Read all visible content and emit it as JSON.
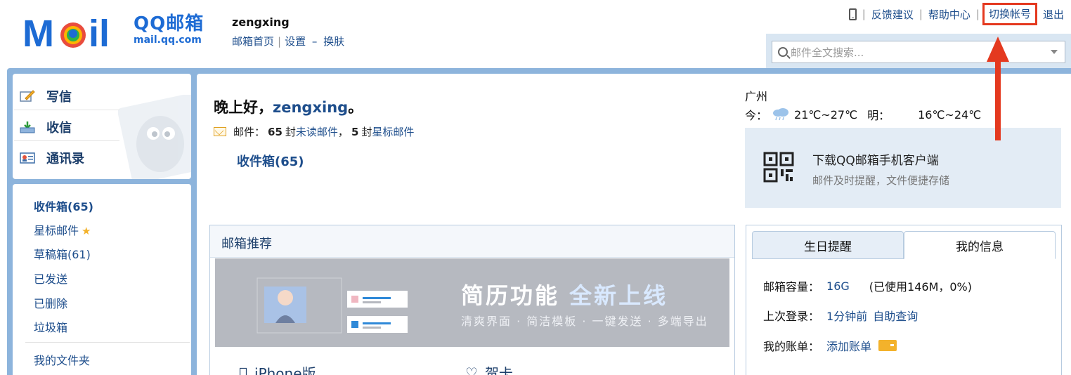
{
  "brand": {
    "logo_text": "Mail",
    "product_name": "QQ邮箱",
    "domain": "mail.qq.com"
  },
  "user": {
    "name": "zengxing",
    "home_link": "邮箱首页",
    "settings_link": "设置",
    "skin_link": "换肤",
    "dash": "–"
  },
  "toplinks": {
    "feedback": "反馈建议",
    "help": "帮助中心",
    "switch_account": "切换帐号",
    "logout": "退出"
  },
  "search": {
    "placeholder": "邮件全文搜索..."
  },
  "sidebar": {
    "compose": "写信",
    "receive": "收信",
    "contacts": "通讯录",
    "folders": [
      {
        "label": "收件箱(65)"
      },
      {
        "label": "星标邮件"
      },
      {
        "label": "草稿箱(61)"
      },
      {
        "label": "已发送"
      },
      {
        "label": "已删除"
      },
      {
        "label": "垃圾箱"
      }
    ],
    "my_folders": "我的文件夹"
  },
  "greeting": {
    "prefix": "晚上好，",
    "name": "zengxing",
    "suffix": "。"
  },
  "mail_summary": {
    "label": "邮件：",
    "unread_count": "65",
    "unit1": "封",
    "unread_label": "未读邮件",
    "comma": "，",
    "star_count": "5",
    "unit2": "封",
    "star_label": "星标邮件"
  },
  "inbox_link": "收件箱(65)",
  "weather": {
    "city": "广州",
    "today_label": "今：",
    "today_range": "21℃~27℃",
    "tomorrow_label": "明：",
    "tomorrow_range": "16℃~24℃"
  },
  "app_promo": {
    "title": "下载QQ邮箱手机客户端",
    "subtitle": "邮件及时提醒，文件便捷存储"
  },
  "recommend": {
    "title": "邮箱推荐",
    "banner_title": "简历功能",
    "banner_title_hl": "全新上线",
    "banner_sub": "清爽界面 · 简洁模板 · 一键发送 · 多端导出",
    "iphone": "iPhone版",
    "card": "贺卡"
  },
  "info": {
    "tab_birthday": "生日提醒",
    "tab_myinfo": "我的信息",
    "capacity_label": "邮箱容量：",
    "capacity_value": "16G",
    "capacity_used": "(已使用146M，0%)",
    "last_login_label": "上次登录：",
    "last_login_value": "1分钟前",
    "self_query": "自助查询",
    "bill_label": "我的账单：",
    "add_bill": "添加账单"
  },
  "colors": {
    "frame": "#8db4dc",
    "link": "#1e4e8c",
    "annotation": "#e4391f",
    "logo_blue": "#1d6bd4"
  }
}
